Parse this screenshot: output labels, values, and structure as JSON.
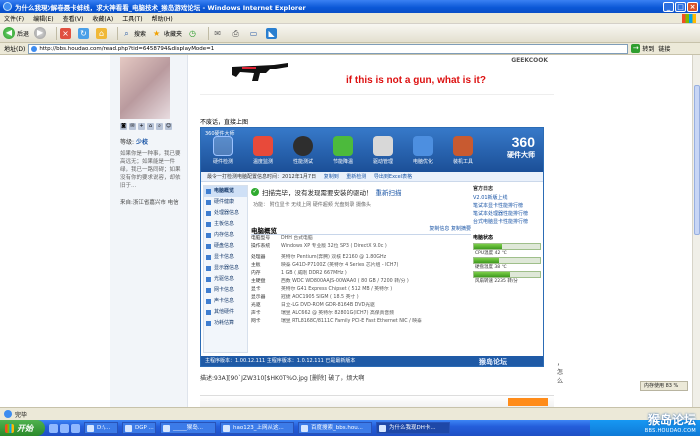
{
  "window": {
    "title": "为什么我現ﾝ解卷聂卡蚌线，求大神看看_电脑技术_猴岛游戏论坛 - Windows Internet Explorer"
  },
  "menu": [
    "文件(F)",
    "编辑(E)",
    "查看(V)",
    "收藏(A)",
    "工具(T)",
    "帮助(H)"
  ],
  "toolbar": {
    "back_label": "后退",
    "search_label": "搜索",
    "favorites_label": "收藏夹"
  },
  "address": {
    "label": "地址(D)",
    "url": "http://bbs.houdao.com/read.php?tid=6458794&displayMode=1",
    "go_label": "转到",
    "links_label": "链接"
  },
  "forum": {
    "rank": "等级: 少校",
    "rank_label": "等级:",
    "rank_value": "少校",
    "signature": "如果你是一种事，我已要高远无；如果能是一件绿，我已一路同碍；如果没有你的要求说容，却依旧于...",
    "location": "来自:浙江省嘉兴市 电信"
  },
  "banner": {
    "brand": "GEEKCOOK",
    "slogan": "if this is not a gun, what is it?"
  },
  "post": {
    "intro": "不废话，直接上图",
    "trailing": "，怎么",
    "caption_code": "描述:93A][90`JZW310[$HK0T%O.jpg",
    "caption_rest": "[删除]  破了，烦大啊"
  },
  "app360": {
    "title": "360硬件大师",
    "tabs": [
      "硬件检测",
      "温度监测",
      "性能测试",
      "节能降温",
      "驱动管理",
      "电脑优化",
      "装机工具"
    ],
    "brand_num": "360",
    "brand_name": "硬件大师",
    "info_text": "最令一打检测电脑配置信息时间：2012年1月7日",
    "info_link1": "复制到",
    "info_link2": "重新检测",
    "info_link3": "导出到Excel表格",
    "nav": [
      "电脑概览",
      "硬件健康",
      "处理器信息",
      "主板信息",
      "内存信息",
      "硬盘信息",
      "显卡信息",
      "显示器信息",
      "光驱信息",
      "网卡信息",
      "声卡信息",
      "其他硬件",
      "功耗估算"
    ],
    "scan_text": "扫描完毕，没有发现需要安装的驱动！",
    "scan_link": "重新扫描",
    "features": "功能：  附位显卡   无线上网   硬件超频   光盘刻录   摄像头",
    "overview_title": "电脑概览",
    "overview_links": "复制信息  复制摘要",
    "specs": [
      {
        "k": "电脑型号",
        "v": "DHH 台式电脑"
      },
      {
        "k": "操作系统",
        "v": "Windows XP 专业版 32位 SP3 ( DirectX 9.0c )"
      },
      {
        "k": "",
        "v": ""
      },
      {
        "k": "处理器",
        "v": "英特尔 Pentium(奔腾) 双核 E2160 @ 1.80GHz"
      },
      {
        "k": "主板",
        "v": "映泰 G41D-P7100Z (英特尔 4 Series 芯片组 - ICH7)"
      },
      {
        "k": "内存",
        "v": "1 GB ( 威刚 DDR2 667MHz )"
      },
      {
        "k": "主硬盘",
        "v": "西数 WDC WD800AAJS-00WAA0 ( 80 GB / 7200 转/分 )"
      },
      {
        "k": "显卡",
        "v": "英特尔 G41 Express Chipset ( 512 MB / 英特尔 )"
      },
      {
        "k": "显示器",
        "v": "冠捷 AOC1905 SIGM ( 18.5 英寸 )"
      },
      {
        "k": "光驱",
        "v": "日立-LG DVD-ROM GDR-8164B DVD光驱"
      },
      {
        "k": "声卡",
        "v": "瑞昱 ALC662 @ 英特尔 82801G(ICH7) 高保真音频"
      },
      {
        "k": "网卡",
        "v": "瑞昱 RTL8168C/8111C Family PCI-E Fast Ethernet NIC / 映泰"
      }
    ],
    "right_title": "官方日志",
    "right_links": [
      "V2.01新版上线",
      "笔试本显卡性能排行榜",
      "笔试本处理器性能排行榜",
      "台式电脑显卡性能排行榜"
    ],
    "right_sub": "电脑状态",
    "meters": [
      {
        "label": "CPU温度  42 ℃",
        "value": 0.42
      },
      {
        "label": "硬盘温度  38 ℃",
        "value": 0.38
      },
      {
        "label": "风扇转速  2235 转/分",
        "value": 0.55
      }
    ],
    "footer": "主程序版本：1.00.12.111    主程序版本：1.0.12.111    已是最新版本",
    "watermark": "猴岛论坛"
  },
  "zoom": "内存使用  83 %",
  "status": "完毕",
  "taskbar": {
    "start": "开始",
    "tasks": [
      "D:\\...",
      "DGP  ...",
      "_____猴岛...",
      "hao123_上网从这...",
      "百度搜索_bbs.hou...",
      "为什么我现DH卡..."
    ],
    "site_cn": "猴岛论坛",
    "site_en": "BBS.HOUDAO.COM"
  },
  "colors": {
    "xp_blue": "#0a57d6",
    "brand_blue": "#1f5aa6",
    "slogan_red": "#dd1111",
    "ok_green": "#2faa2f"
  }
}
